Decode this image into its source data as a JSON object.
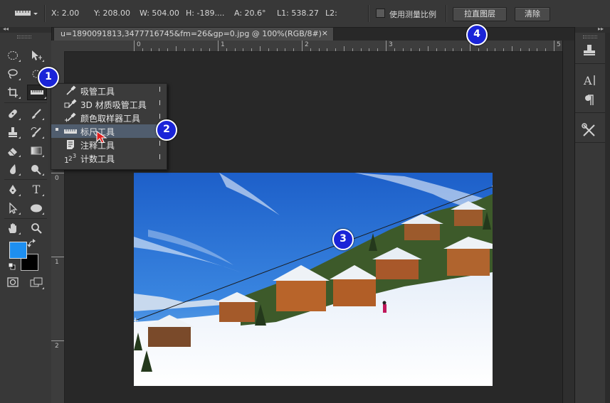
{
  "options_bar": {
    "x": "X: 2.00",
    "y": "Y: 208.00",
    "w": "W: 504.00",
    "h": "H: -189....",
    "a": "A: 20.6°",
    "l1": "L1: 538.27",
    "l2": "L2:",
    "use_scale_label": "使用测量比例",
    "straighten_label": "拉直图层",
    "clear_label": "清除"
  },
  "document": {
    "tab_title": "u=1890091813,3477716745&fm=26&gp=0.jpg @ 100%(RGB/8#)",
    "close": "×"
  },
  "ruler": {
    "h_labels": [
      "0",
      "1",
      "2",
      "3",
      "4",
      "5"
    ],
    "v_labels": [
      "0",
      "1",
      "2"
    ]
  },
  "flyout_menu": {
    "items": [
      {
        "label": "吸管工具",
        "key": "I",
        "icon": "eyedropper-icon",
        "active": false
      },
      {
        "label": "3D 材质吸管工具",
        "key": "I",
        "icon": "3d-eyedropper-icon",
        "active": false
      },
      {
        "label": "颜色取样器工具",
        "key": "I",
        "icon": "color-sampler-icon",
        "active": false
      },
      {
        "label": "标尺工具",
        "key": "I",
        "icon": "ruler-icon",
        "active": true
      },
      {
        "label": "注释工具",
        "key": "I",
        "icon": "note-icon",
        "active": false
      },
      {
        "label": "计数工具",
        "key": "I",
        "icon": "count-icon",
        "active": false
      }
    ]
  },
  "badges": [
    "1",
    "2",
    "3",
    "4"
  ],
  "colors": {
    "foreground": "#1e8ff0",
    "background": "#000000",
    "badge": "#1a24d8",
    "ui_bg": "#383838",
    "canvas_bg": "#282828"
  }
}
